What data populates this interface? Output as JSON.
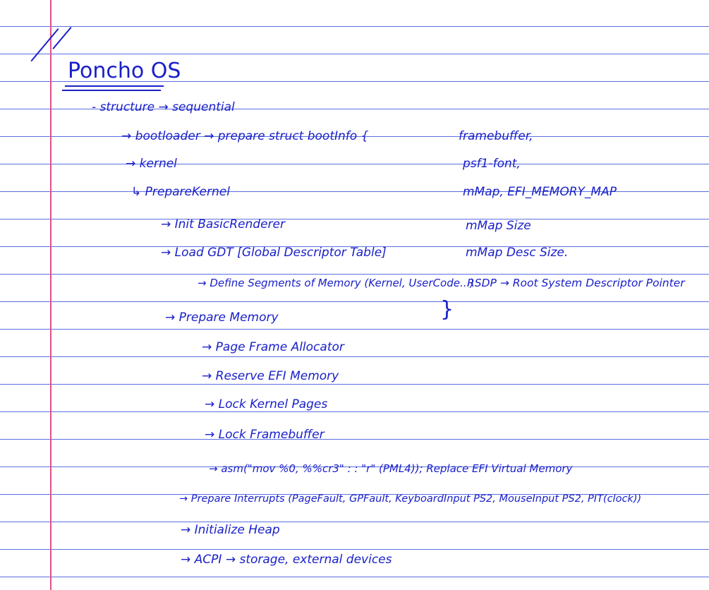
{
  "title": "Poncho OS",
  "lines": {
    "l1": "- structure → sequential",
    "l2": "→ bootloader → prepare struct bootInfo {",
    "l3": "→ kernel",
    "l4": "↳ PrepareKernel",
    "l5": "→ Init BasicRenderer",
    "l6": "→ Load GDT [Global Descriptor Table]",
    "l7": "→ Define Segments of Memory (Kernel, UserCode...)",
    "l8": "→ Prepare Memory",
    "l9": "→ Page Frame Allocator",
    "l10": "→ Reserve EFI Memory",
    "l11": "→ Lock Kernel Pages",
    "l12": "→ Lock Framebuffer",
    "l13": "→ asm(\"mov %0, %%cr3\" : : \"r\" (PML4)); Replace EFI Virtual Memory",
    "l14": "→ Prepare Interrupts (PageFault, GPFault, KeyboardInput PS2, MouseInput PS2, PIT(clock))",
    "l15": "→ Initialize Heap",
    "l16": "→ ACPI → storage, external devices"
  },
  "bootinfo": {
    "b1": "framebuffer,",
    "b2": "psf1-font,",
    "b3": "mMap, EFI_MEMORY_MAP",
    "b4": "mMap Size",
    "b5": "mMap Desc Size.",
    "b6": "RSDP → Root System Descriptor Pointer",
    "close": "}"
  }
}
